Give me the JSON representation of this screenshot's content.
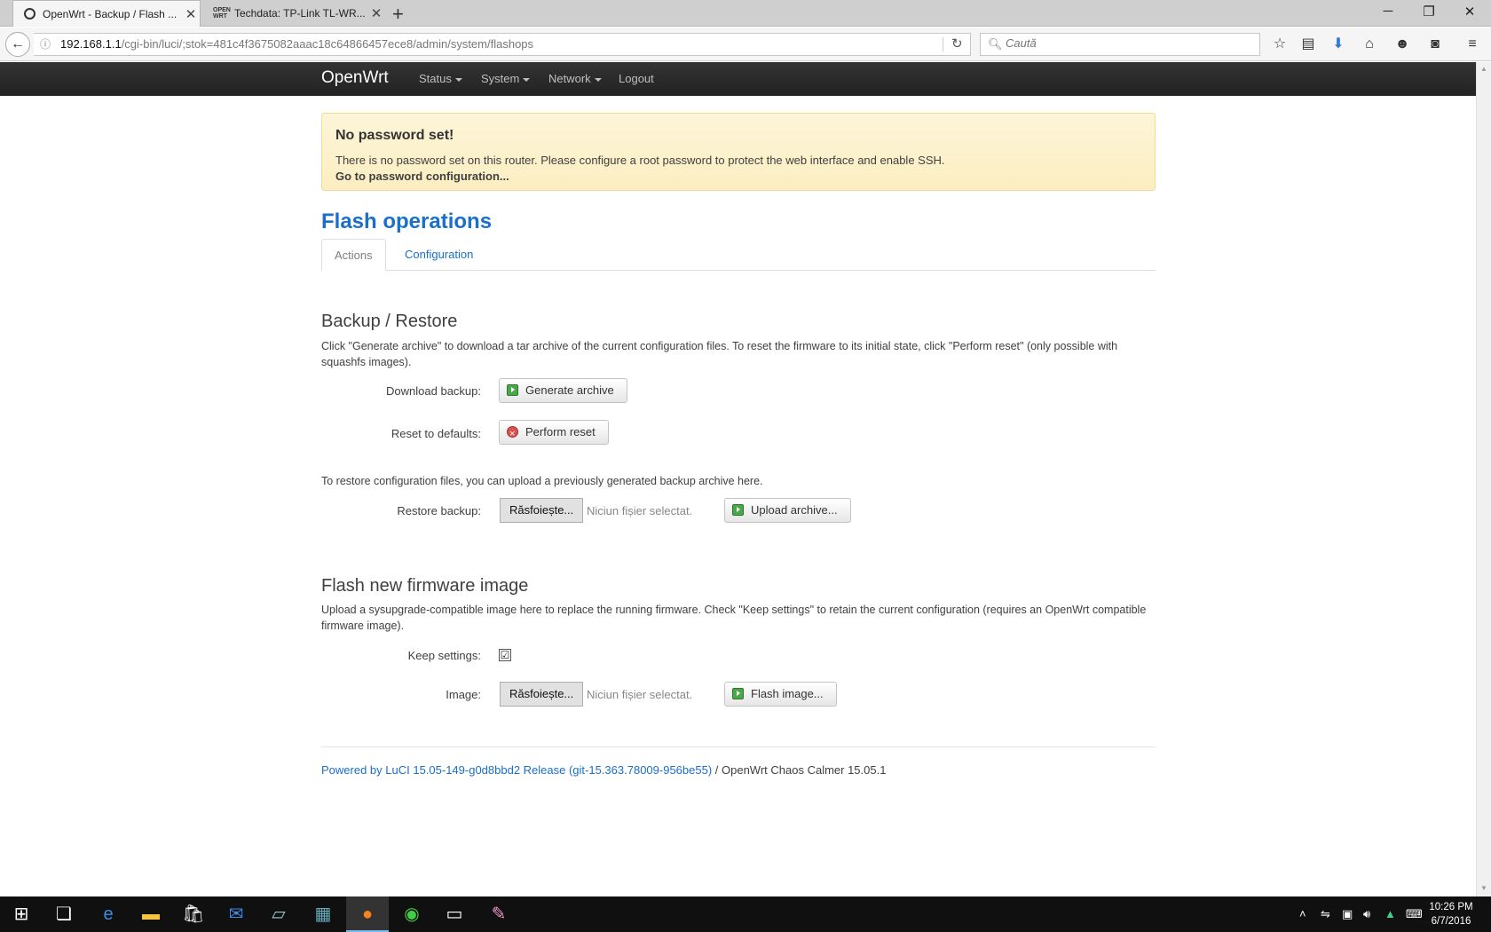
{
  "browser": {
    "tabs": [
      {
        "title": "OpenWrt - Backup / Flash ..."
      },
      {
        "title": "Techdata: TP-Link TL-WR..."
      }
    ],
    "url_host": "192.168.1.1",
    "url_path": "/cgi-bin/luci/;stok=481c4f3675082aaac18c64866457ece8/admin/system/flashops",
    "search_placeholder": "Caută"
  },
  "header": {
    "brand": "OpenWrt",
    "menu": [
      "Status",
      "System",
      "Network",
      "Logout"
    ]
  },
  "alert": {
    "title": "No password set!",
    "message": "There is no password set on this router. Please configure a root password to protect the web interface and enable SSH.",
    "link": "Go to password configuration..."
  },
  "page": {
    "title": "Flash operations",
    "tabs": [
      "Actions",
      "Configuration"
    ]
  },
  "backup": {
    "title": "Backup / Restore",
    "description": "Click \"Generate archive\" to download a tar archive of the current configuration files. To reset the firmware to its initial state, click \"Perform reset\" (only possible with squashfs images).",
    "download_label": "Download backup:",
    "generate_button": "Generate archive",
    "reset_label": "Reset to defaults:",
    "reset_button": "Perform reset",
    "restore_description": "To restore configuration files, you can upload a previously generated backup archive here.",
    "restore_label": "Restore backup:",
    "browse_button": "Răsfoiește...",
    "no_file": "Niciun fișier selectat.",
    "upload_button": "Upload archive..."
  },
  "flash": {
    "title": "Flash new firmware image",
    "description": "Upload a sysupgrade-compatible image here to replace the running firmware. Check \"Keep settings\" to retain the current configuration (requires an OpenWrt compatible firmware image).",
    "keep_label": "Keep settings:",
    "keep_checked": "☑",
    "image_label": "Image:",
    "browse_button": "Răsfoiește...",
    "no_file": "Niciun fișier selectat.",
    "flash_button": "Flash image..."
  },
  "footer": {
    "link": "Powered by LuCI 15.05-149-g0d8bbd2 Release (git-15.363.78009-956be55)",
    "text": " / OpenWrt Chaos Calmer 15.05.1"
  },
  "taskbar": {
    "time": "10:26 PM",
    "date": "6/7/2016"
  }
}
